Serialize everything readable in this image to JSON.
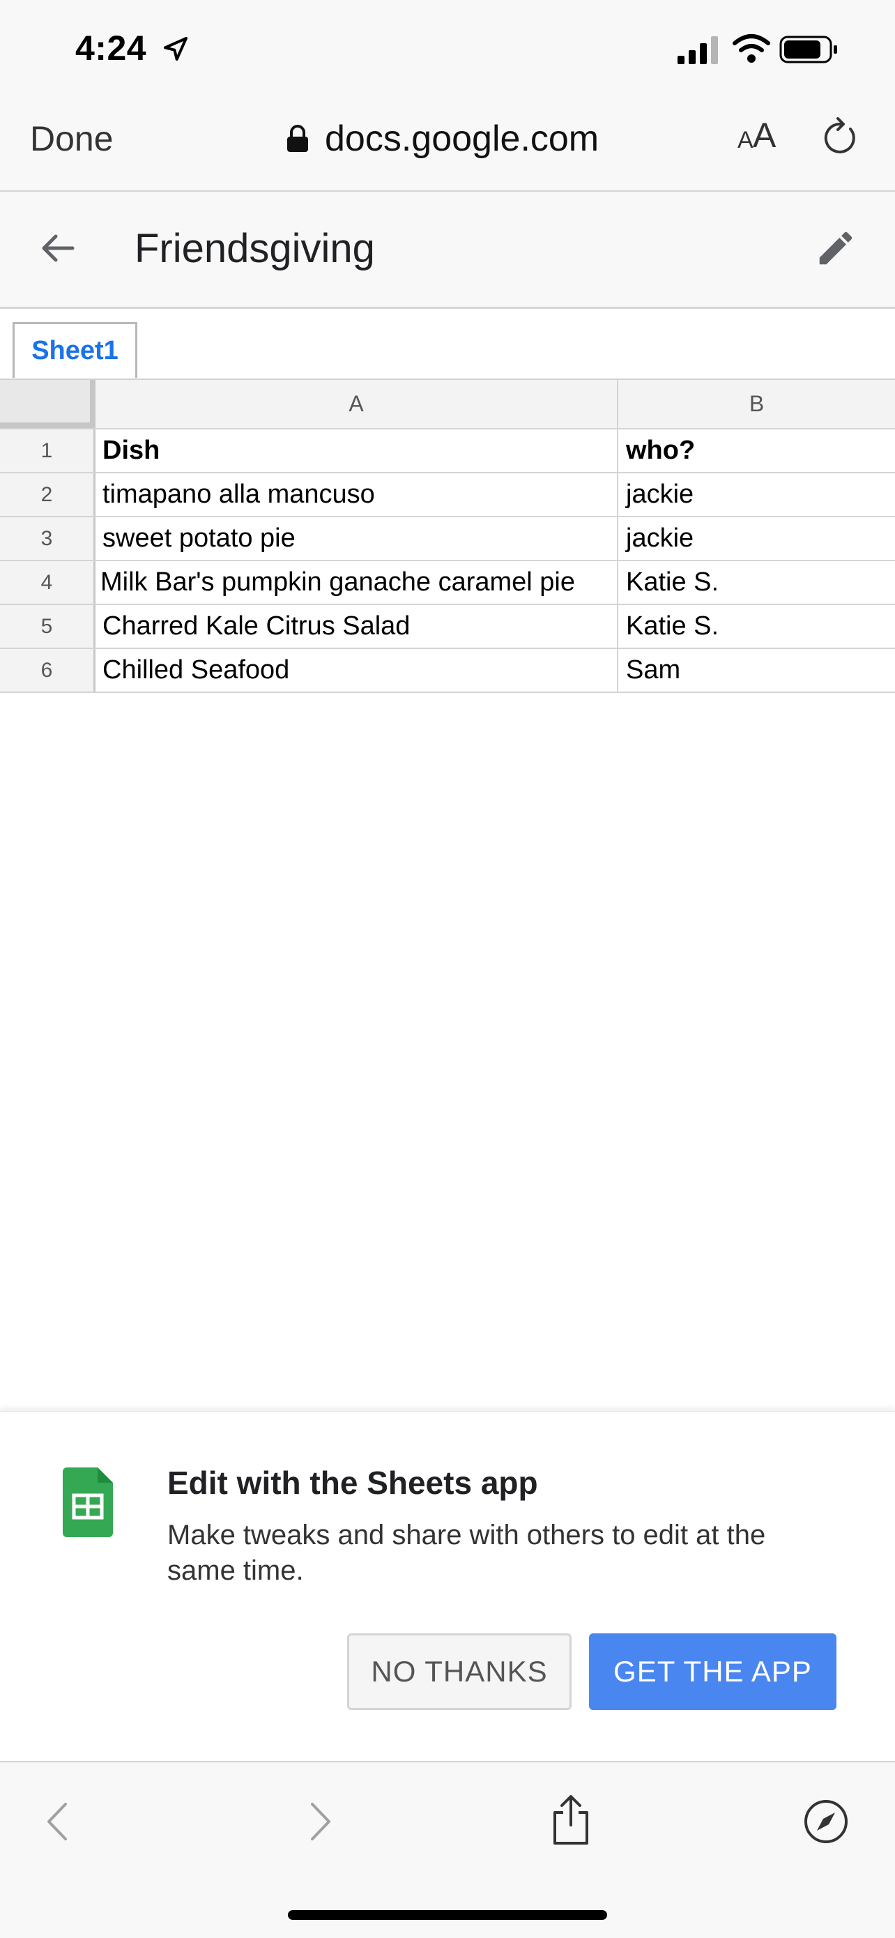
{
  "status_bar": {
    "time": "4:24"
  },
  "address_bar": {
    "done_label": "Done",
    "url": "docs.google.com",
    "aa_small": "A",
    "aa_big": "A"
  },
  "doc": {
    "title": "Friendsgiving"
  },
  "sheet": {
    "tab_label": "Sheet1",
    "columns": [
      "A",
      "B"
    ],
    "rows": [
      {
        "num": "1",
        "a": "Dish",
        "b": "who?"
      },
      {
        "num": "2",
        "a": "timapano alla mancuso",
        "b": "jackie"
      },
      {
        "num": "3",
        "a": "sweet potato pie",
        "b": "jackie"
      },
      {
        "num": "4",
        "a": "Milk Bar's pumpkin ganache caramel pie",
        "b": "Katie S."
      },
      {
        "num": "5",
        "a": "Charred Kale Citrus Salad",
        "b": "Katie S."
      },
      {
        "num": "6",
        "a": "Chilled Seafood",
        "b": "Sam"
      }
    ]
  },
  "promo": {
    "title": "Edit with the Sheets app",
    "body": "Make tweaks and share with others to edit at the same time.",
    "no_thanks_label": "NO THANKS",
    "get_app_label": "GET THE APP"
  },
  "colors": {
    "accent_blue": "#4a86f0",
    "tab_blue": "#1a73e8",
    "sheets_green": "#34a853"
  },
  "icons": [
    "location-arrow-icon",
    "signal-icon",
    "wifi-icon",
    "battery-icon",
    "lock-icon",
    "reload-icon",
    "back-arrow-icon",
    "edit-pencil-icon",
    "sheets-logo-icon",
    "browser-back-icon",
    "browser-forward-icon",
    "share-icon",
    "compass-icon"
  ]
}
